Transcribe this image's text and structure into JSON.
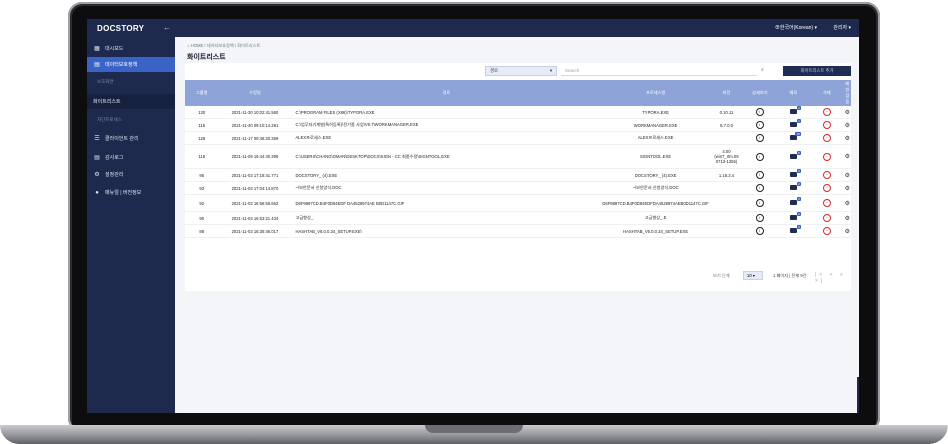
{
  "app": {
    "logo": "DOCSTORY",
    "collapse_icon": "arrow-left-icon"
  },
  "topbar": {
    "language": "⊕한국어(Korean) ▾",
    "user": "관리자 ▾"
  },
  "sidebar": {
    "items": [
      {
        "label": "대시보드",
        "icon": "dashboard-icon"
      },
      {
        "label": "데이터보호정책",
        "icon": "doc-lock-icon",
        "active": true
      }
    ],
    "group1": "보호화면",
    "sub_item": "화이트리스트",
    "group2": "차단프로세스",
    "items2": [
      {
        "label": "클라이언트 관리",
        "icon": "list-icon"
      },
      {
        "label": "감사로그",
        "icon": "log-icon"
      },
      {
        "label": "설정관리",
        "icon": "settings-icon"
      },
      {
        "label": "매뉴얼 | 버전정보",
        "icon": "info-icon"
      }
    ]
  },
  "breadcrumb": "⌂ HOME / 데이터보호정책 / 화이트리스트",
  "page_title": "화이트리스트",
  "filter": {
    "selected": "경로",
    "placeholder": "Search",
    "add_button": "화이트리스트 추가"
  },
  "table": {
    "headers": [
      "그룹명",
      "수정일",
      "경로",
      "프로세스명",
      "버전",
      "상세보기",
      "메모",
      "삭제",
      "매칭 검증"
    ],
    "rows": [
      {
        "group": "130",
        "date": "2021-11-30 10:02:41.560",
        "path": "C:\\PROGRAM FILES (X86)\\TYPORA.EXE",
        "proc": "TYPORA.EXE",
        "ver": "0.10.11",
        "memo": "2",
        "cls": ""
      },
      {
        "group": "116",
        "date": "2021-11-30 09:10:14.281",
        "path": "C:\\업무자기계발(특허등록)\\전기종 사업\\V8.7\\WORKMANAGER.EXE",
        "proc": "WORKMANAGER.EXE",
        "ver": "8.7.0.0",
        "memo": "1",
        "cls": ""
      },
      {
        "group": "128",
        "date": "2021-11-17 09:48:20.369",
        "path": "ALEX프로세스.EXE",
        "proc": "ALEX프로세스.EXE",
        "ver": "",
        "memo": "19",
        "cls": ""
      },
      {
        "group": "118",
        "date": "2021-11-09 15:44:40.399",
        "path": "C:\\USERS\\CHANG\\OMAN\\DESKTOP\\DOCS\\SIGN - CC 최종수정\\SIGNTOOL.EXE",
        "proc": "SIGNTOOL.EXE",
        "ver": "4.00 (win7_rtm.09 0713-1255)",
        "memo": "5",
        "cls": "tall"
      },
      {
        "group": "95",
        "date": "2021-11-03 17:18:41.771",
        "path": "DOCSTORY_ (4).EXE",
        "proc": "DOCSTORY_ (4).EXE",
        "ver": "1.16.3.4",
        "memo": "2",
        "cls": ""
      },
      {
        "group": "93",
        "date": "2021-11-03 17:04:14.870",
        "path": "~\\보안문서 신청양식.DOC",
        "proc": "~\\보안문서 신청양식.DOC",
        "ver": "",
        "memo": "2",
        "cls": ""
      },
      {
        "group": "92",
        "date": "2021-11-03 16:58:56.662",
        "path": "D6F9897CD.B4F0D84EDF DA4528974AE B0D1147C.GIF",
        "proc": "D6F9897CD.B4F0D84EDFDA4528974AEB0D1147C.GIF",
        "ver": "",
        "memo": "2",
        "cls": "mid"
      },
      {
        "group": "90",
        "date": "2021-11-03 16:53:21.434",
        "path": "고급향상_",
        "proc": "고급향상_.E",
        "ver": "",
        "memo": "2",
        "cls": ""
      },
      {
        "group": "88",
        "date": "2021-11-03 16:35:46.017",
        "path": "HASHTAB_V6.0.0.34_SETUP.EXE\\",
        "proc": "HASHTAB_V6.0.0.34_SETUP.EXE",
        "ver": "",
        "memo": "2",
        "cls": ""
      }
    ]
  },
  "pagination": {
    "label": "보기 단계",
    "size": "10 ▾",
    "info": "1 페이지 | 전체 9건",
    "nav": "|< < > >|"
  }
}
